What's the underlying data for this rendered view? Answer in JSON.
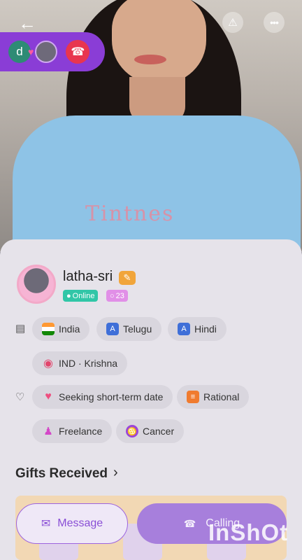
{
  "header": {
    "back_icon": "arrow-left-icon",
    "report_icon": "warning-triangle-icon",
    "more_icon": "more-dots-icon"
  },
  "call_pill": {
    "avatar_letter": "d",
    "heart_icon": "heart-icon",
    "hangup_icon": "phone-hangup-icon"
  },
  "profile": {
    "name": "latha-sri",
    "status": "Online",
    "count": "23",
    "colors": {
      "online": "#31c6a7",
      "count": "#e18fe7",
      "accent": "#8a3dd6"
    }
  },
  "info_chips": [
    {
      "label": "India",
      "icon": "india-flag-icon"
    },
    {
      "label": "Telugu",
      "icon": "language-icon"
    },
    {
      "label": "Hindi",
      "icon": "language-icon"
    },
    {
      "label": "IND · Krishna",
      "icon": "location-pin-icon"
    }
  ],
  "trait_chips": [
    {
      "label": "Seeking short-term date",
      "icon": "heart-icon"
    },
    {
      "label": "Rational",
      "icon": "list-icon"
    },
    {
      "label": "Freelance",
      "icon": "person-icon"
    },
    {
      "label": "Cancer",
      "icon": "zodiac-cancer-icon"
    }
  ],
  "gifts": {
    "title": "Gifts Received"
  },
  "actions": {
    "message": "Message",
    "calling": "Calling"
  },
  "watermark": "InShOt",
  "shirt_text": "Tintnes"
}
